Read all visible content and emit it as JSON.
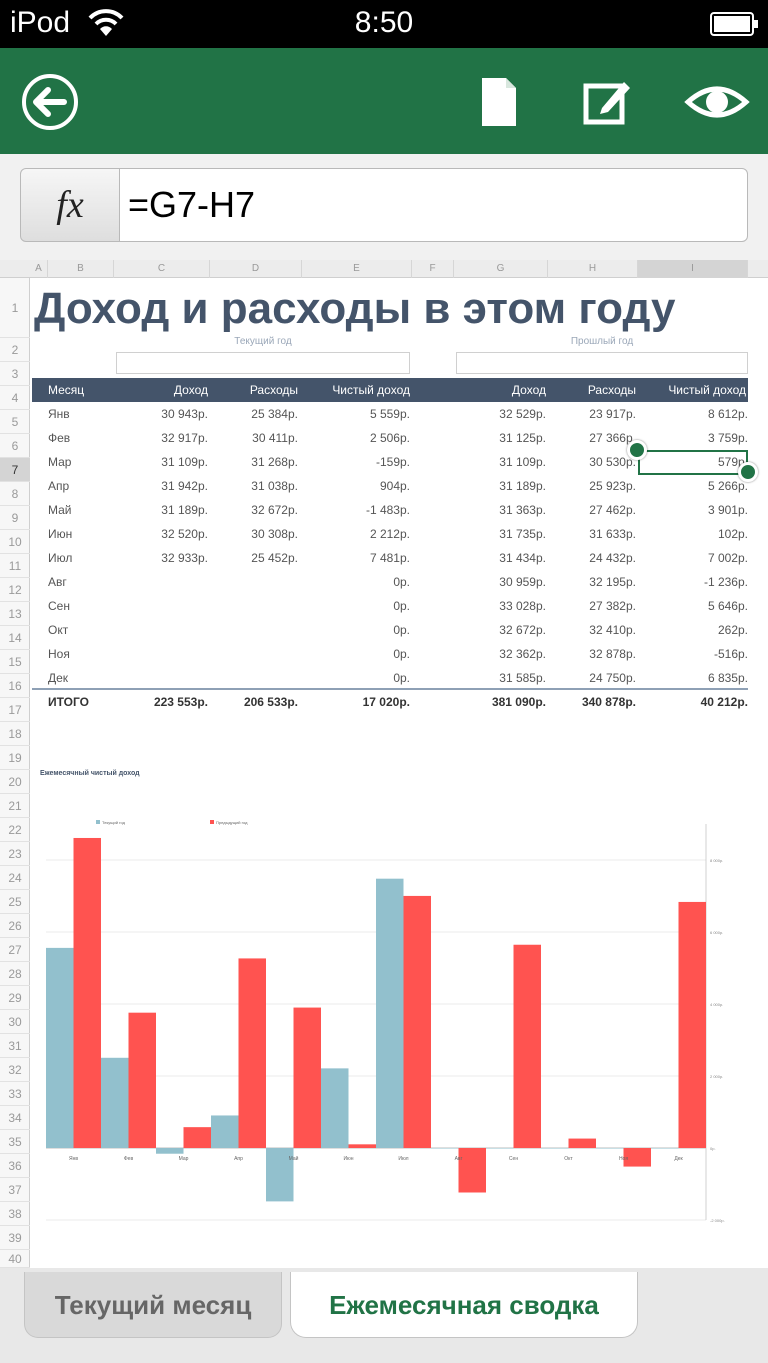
{
  "status": {
    "carrier": "iPod",
    "time": "8:50"
  },
  "formula": {
    "fx": "fx",
    "value": "=G7-H7"
  },
  "columns": [
    "A",
    "B",
    "C",
    "D",
    "E",
    "F",
    "G",
    "H",
    "I"
  ],
  "rows": [
    "1",
    "2",
    "3",
    "4",
    "5",
    "6",
    "7",
    "8",
    "9",
    "10",
    "11",
    "12",
    "13",
    "14",
    "15",
    "16",
    "17",
    "18",
    "19",
    "20",
    "21",
    "22",
    "23",
    "24",
    "25",
    "26",
    "27",
    "28",
    "29",
    "30",
    "31",
    "32",
    "33",
    "34",
    "35",
    "36",
    "37",
    "38",
    "39",
    "40"
  ],
  "sheet": {
    "title": "Доход и расходы в этом году",
    "current_year_label": "Текущий год",
    "previous_year_label": "Прошлый год",
    "headers": [
      "Месяц",
      "Доход",
      "Расходы",
      "Чистый доход",
      "Доход",
      "Расходы",
      "Чистый доход"
    ],
    "data_rows": [
      [
        "Янв",
        "30 943р.",
        "25 384р.",
        "5 559р.",
        "32 529р.",
        "23 917р.",
        "8 612р."
      ],
      [
        "Фев",
        "32 917р.",
        "30 411р.",
        "2 506р.",
        "31 125р.",
        "27 366р.",
        "3 759р."
      ],
      [
        "Мар",
        "31 109р.",
        "31 268р.",
        "-159р.",
        "31 109р.",
        "30 530р.",
        "579р."
      ],
      [
        "Апр",
        "31 942р.",
        "31 038р.",
        "904р.",
        "31 189р.",
        "25 923р.",
        "5 266р."
      ],
      [
        "Май",
        "31 189р.",
        "32 672р.",
        "-1 483р.",
        "31 363р.",
        "27 462р.",
        "3 901р."
      ],
      [
        "Июн",
        "32 520р.",
        "30 308р.",
        "2 212р.",
        "31 735р.",
        "31 633р.",
        "102р."
      ],
      [
        "Июл",
        "32 933р.",
        "25 452р.",
        "7 481р.",
        "31 434р.",
        "24 432р.",
        "7 002р."
      ],
      [
        "Авг",
        "",
        "",
        "0р.",
        "30 959р.",
        "32 195р.",
        "-1 236р."
      ],
      [
        "Сен",
        "",
        "",
        "0р.",
        "33 028р.",
        "27 382р.",
        "5 646р."
      ],
      [
        "Окт",
        "",
        "",
        "0р.",
        "32 672р.",
        "32 410р.",
        "262р."
      ],
      [
        "Ноя",
        "",
        "",
        "0р.",
        "32 362р.",
        "32 878р.",
        "-516р."
      ],
      [
        "Дек",
        "",
        "",
        "0р.",
        "31 585р.",
        "24 750р.",
        "6 835р."
      ]
    ],
    "total_row": [
      "ИТОГО",
      "223 553р.",
      "206 533р.",
      "17 020р.",
      "381 090р.",
      "340 878р.",
      "40 212р."
    ]
  },
  "chart_data": {
    "type": "bar",
    "title": "Ежемесячный чистый доход",
    "categories": [
      "Янв",
      "Фев",
      "Мар",
      "Апр",
      "Май",
      "Июн",
      "Июл",
      "Авг",
      "Сен",
      "Окт",
      "Ноя",
      "Дек"
    ],
    "series": [
      {
        "name": "Текущий год",
        "color": "#92c0cd",
        "values": [
          5559,
          2506,
          -159,
          904,
          -1483,
          2212,
          7481,
          0,
          0,
          0,
          0,
          0
        ]
      },
      {
        "name": "Предыдущий год",
        "color": "#ff5350",
        "values": [
          8612,
          3759,
          579,
          5266,
          3901,
          102,
          7002,
          -1236,
          5646,
          262,
          -516,
          6835
        ]
      }
    ],
    "ylim": [
      -2000,
      9000
    ],
    "yticks": [
      -2000,
      0,
      2000,
      4000,
      6000,
      8000
    ],
    "grid": true,
    "legend": "top-left"
  },
  "tabs": {
    "current_month": "Текущий месяц",
    "monthly_summary": "Ежемесячная сводка"
  },
  "colors": {
    "toolbar": "#217346",
    "header_fill": "#44546a",
    "active_tab_text": "#217346"
  }
}
